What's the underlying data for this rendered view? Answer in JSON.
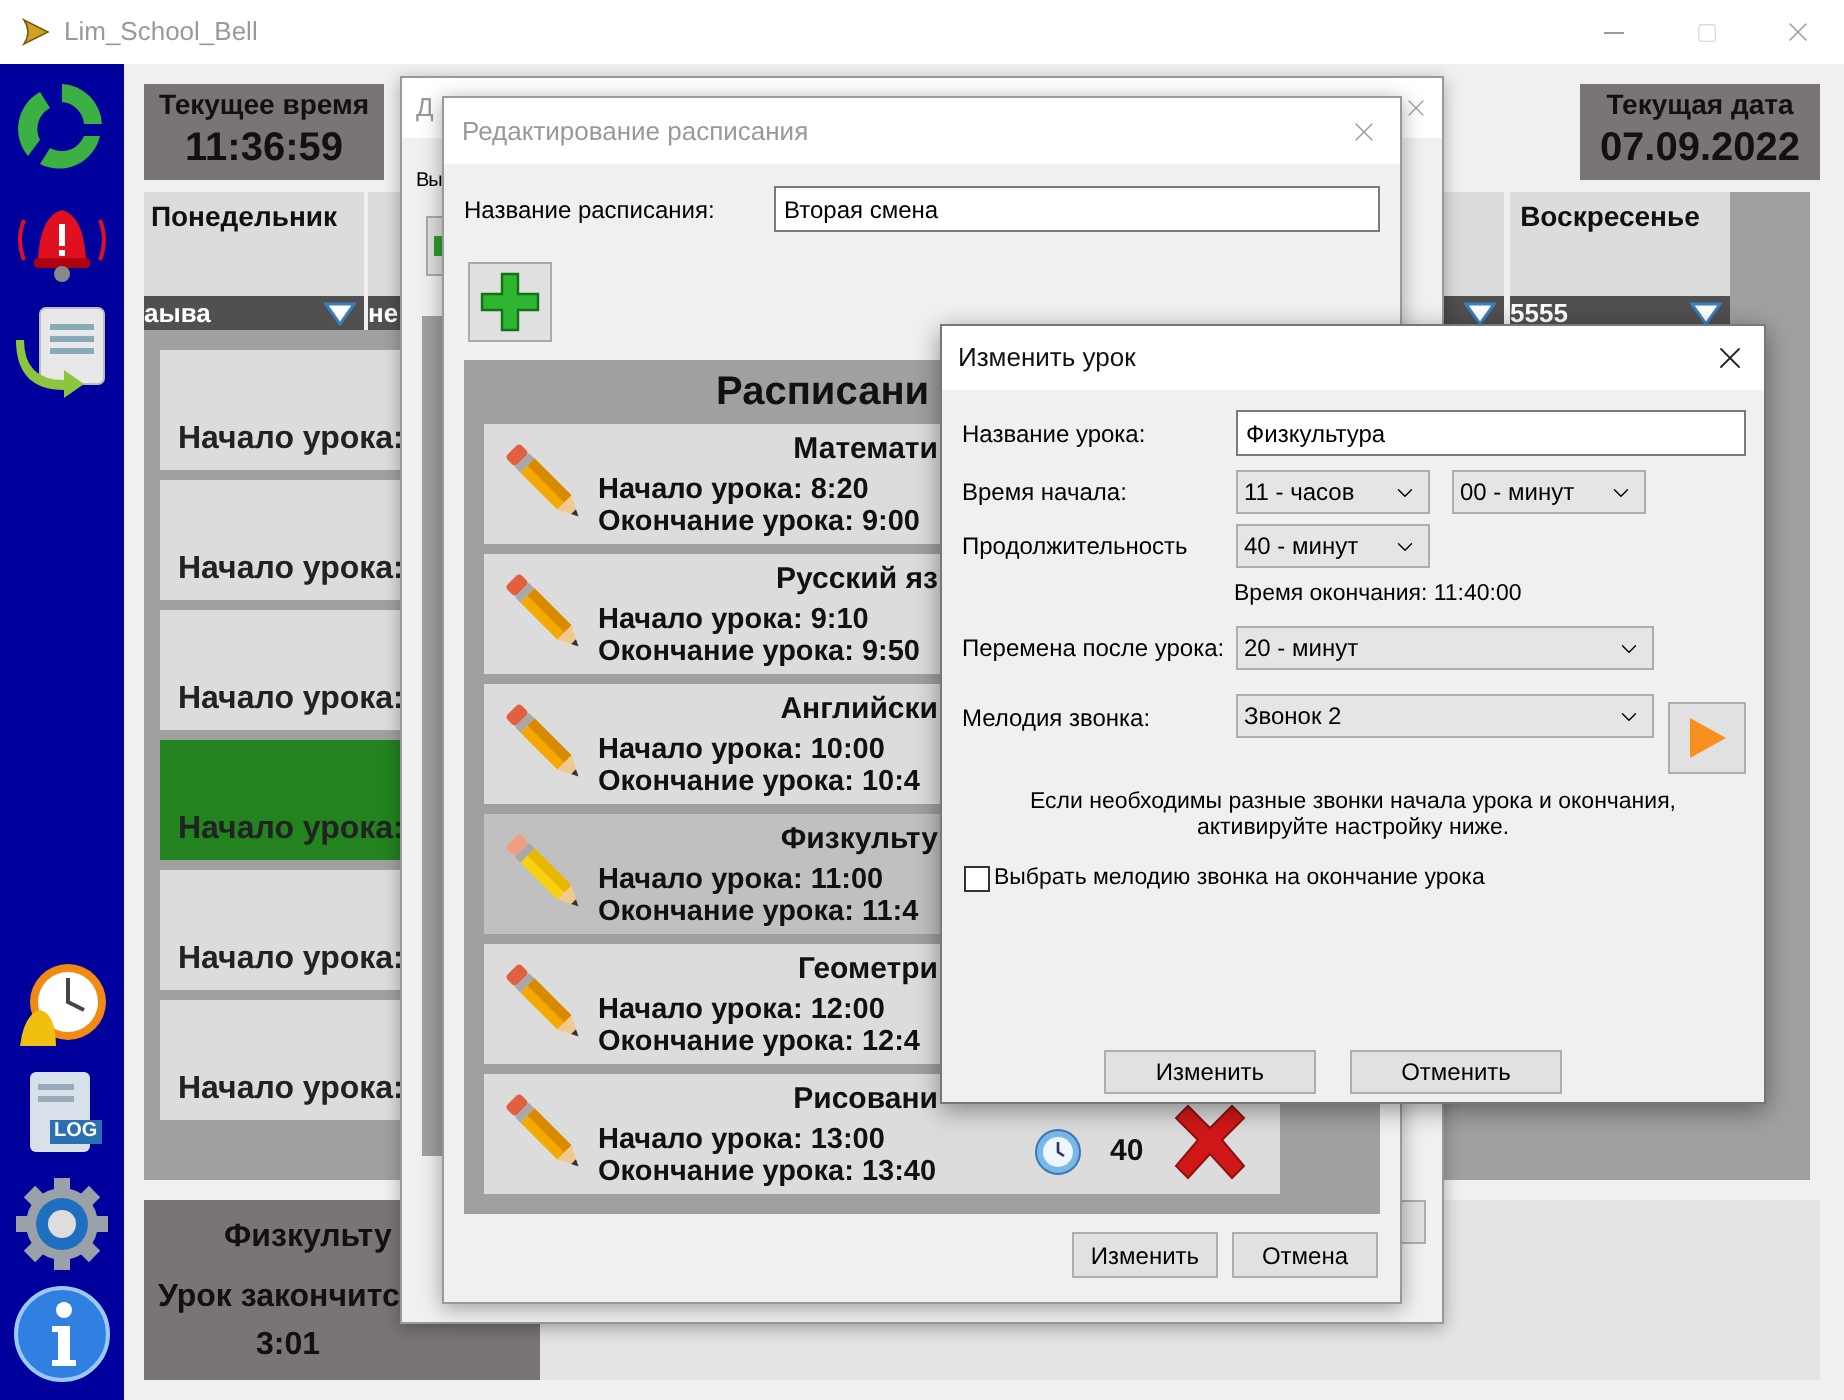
{
  "main_window": {
    "title": "Lim_School_Bell",
    "current_time": {
      "label": "Текущее время",
      "value": "11:36:59"
    },
    "current_date": {
      "label": "Текущая дата",
      "value": "07.09.2022"
    },
    "days": [
      {
        "name": "Понедельник",
        "schedule": "аыва"
      },
      {
        "schedule": "не"
      },
      {
        "name": "Воскресенье",
        "schedule": "5555"
      }
    ],
    "lessons": [
      {
        "label": "Начало урока:",
        "current": false
      },
      {
        "label": "Начало урока:",
        "current": false
      },
      {
        "label": "Начало урока:",
        "current": false
      },
      {
        "label": "Начало урока:",
        "current": true
      },
      {
        "label": "Начало урока:",
        "current": false
      },
      {
        "label": "Начало урока:",
        "current": false
      }
    ],
    "current_lesson": {
      "name": "Физкульту",
      "remaining": "Урок закончитс",
      "time": "3:01"
    },
    "sidebar": {
      "log_badge": "LOG"
    }
  },
  "schedule_list_dialog": {
    "title": "Д",
    "label": "Вы"
  },
  "schedule_editor": {
    "title": "Редактирование расписания",
    "name_label": "Название расписания:",
    "name_value": "Вторая смена",
    "panel_title": "Расписани",
    "lessons": [
      {
        "name": "Математи",
        "start": "Начало урока: 8:20",
        "end": "Окончание урока: 9:00",
        "selected": false
      },
      {
        "name": "Русский яз",
        "start": "Начало урока: 9:10",
        "end": "Окончание урока: 9:50",
        "selected": false
      },
      {
        "name": "Английски",
        "start": "Начало урока: 10:00",
        "end": "Окончание урока: 10:4",
        "selected": false
      },
      {
        "name": "Физкульту",
        "start": "Начало урока: 11:00",
        "end": "Окончание урока: 11:4",
        "selected": true
      },
      {
        "name": "Геометри",
        "start": "Начало урока: 12:00",
        "end": "Окончание урока: 12:4",
        "selected": false
      },
      {
        "name": "Рисовани",
        "start": "Начало урока: 13:00",
        "end": "Окончание урока: 13:40",
        "selected": false,
        "duration": "40"
      }
    ],
    "buttons": [
      "Изменить",
      "Отмена"
    ]
  },
  "lesson_dialog": {
    "title": "Изменить урок",
    "name_label": "Название урока:",
    "name_value": "Физкультура",
    "start_label": "Время начала:",
    "start_hours": "11 - часов",
    "start_minutes": "00 - минут",
    "duration_label": "Продолжительность",
    "duration": "40 - минут",
    "end_time": "Время окончания: 11:40:00",
    "break_label": "Перемена после урока:",
    "break": "20 - минут",
    "melody_label": "Мелодия звонка:",
    "melody": "Звонок 2",
    "hint": "Если необходимы разные звонки начала урока и окончания,\nактивируйте настройку ниже.",
    "end_melody": {
      "label": "Выбрать мелодию звонка на окончание урока",
      "checked": false
    },
    "buttons": [
      "Изменить",
      "Отменить"
    ]
  }
}
